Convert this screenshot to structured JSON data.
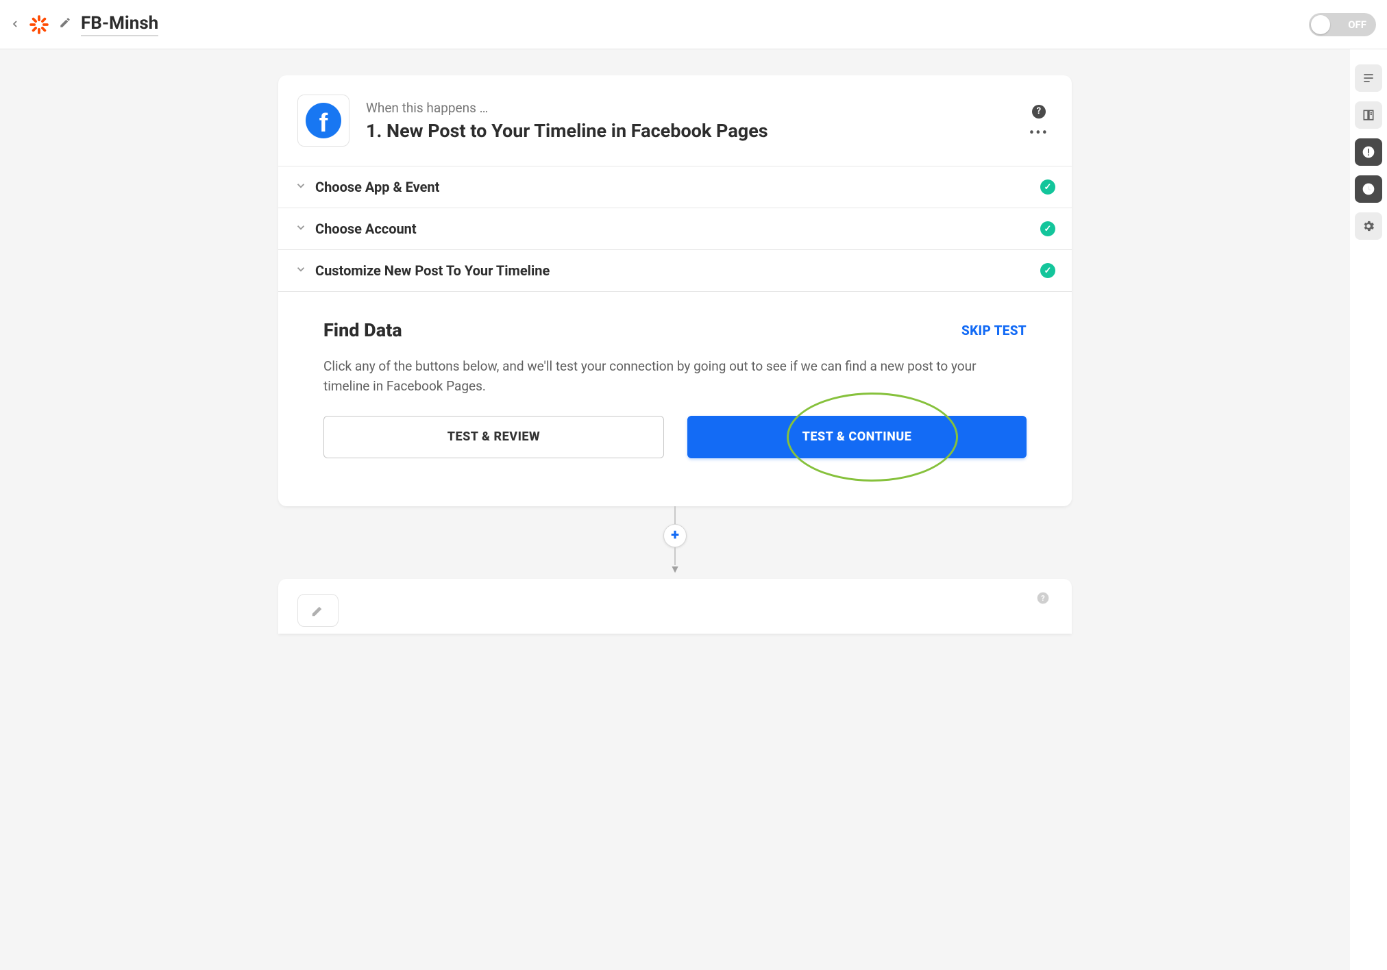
{
  "header": {
    "zap_name": "FB-Minsh",
    "toggle_state": "OFF"
  },
  "right_rail": {
    "items": [
      "menu-icon",
      "book-icon",
      "alert-icon",
      "clock-icon",
      "gear-icon"
    ]
  },
  "step1": {
    "app_icon": "facebook-icon",
    "eyebrow": "When this happens …",
    "title": "1. New Post to Your Timeline in Facebook Pages",
    "sections": [
      {
        "label": "Choose App & Event",
        "complete": true
      },
      {
        "label": "Choose Account",
        "complete": true
      },
      {
        "label": "Customize New Post To Your Timeline",
        "complete": true
      }
    ],
    "find_data": {
      "title": "Find Data",
      "skip_label": "SKIP TEST",
      "description": "Click any of the buttons below, and we'll test your connection by going out to see if we can find a new post to your timeline in Facebook Pages.",
      "test_review_label": "TEST & REVIEW",
      "test_continue_label": "TEST & CONTINUE"
    }
  },
  "add_step_label": "+",
  "annotation": {
    "highlight_target": "test-continue-button"
  }
}
